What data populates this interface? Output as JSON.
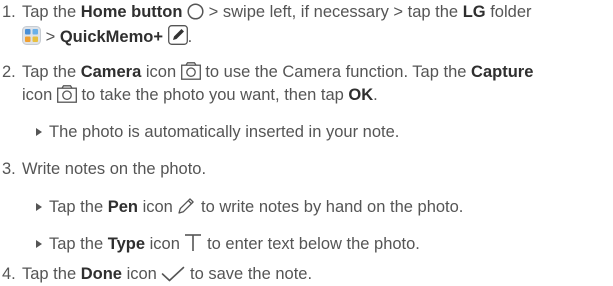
{
  "steps": {
    "s1": {
      "number": "1.",
      "t1": "Tap the",
      "home": "Home button",
      "t2": "> swipe left, if necessary > tap the",
      "lg": "LG",
      "t3": "folder",
      "t4": ">",
      "quickmemo": "QuickMemo+",
      "t5": "."
    },
    "s2": {
      "number": "2.",
      "t1": "Tap the",
      "camera": "Camera",
      "t2": "icon",
      "t3": "to use the Camera function. Tap the",
      "capture": "Capture",
      "t4": "icon",
      "t5": "to take the photo you want, then tap",
      "ok": "OK",
      "t6": ".",
      "bullet": "The photo is automatically inserted in your note."
    },
    "s3": {
      "number": "3.",
      "text": "Write notes on the photo.",
      "b1_t1": "Tap the",
      "pen": "Pen",
      "b1_t2": "icon",
      "b1_t3": "to write notes by hand on the photo.",
      "b2_t1": "Tap the",
      "type": "Type",
      "b2_t2": "icon",
      "b2_t3": "to enter text below the photo."
    },
    "s4": {
      "number": "4.",
      "t1": "Tap the",
      "done": "Done",
      "t2": "icon",
      "t3": "to save the note."
    }
  },
  "icons": {
    "home": "home-circle-icon",
    "lg_folder": "lg-folder-icon",
    "quickmemo": "quickmemo-pen-icon",
    "camera": "camera-icon",
    "capture": "capture-icon",
    "pen": "pen-icon",
    "type": "type-t-icon",
    "done": "checkmark-icon"
  },
  "colors": {
    "text": "#555555",
    "bold": "#2f2f2f",
    "folder_blue": "#4a8fd6",
    "folder_orange": "#f0a030"
  }
}
